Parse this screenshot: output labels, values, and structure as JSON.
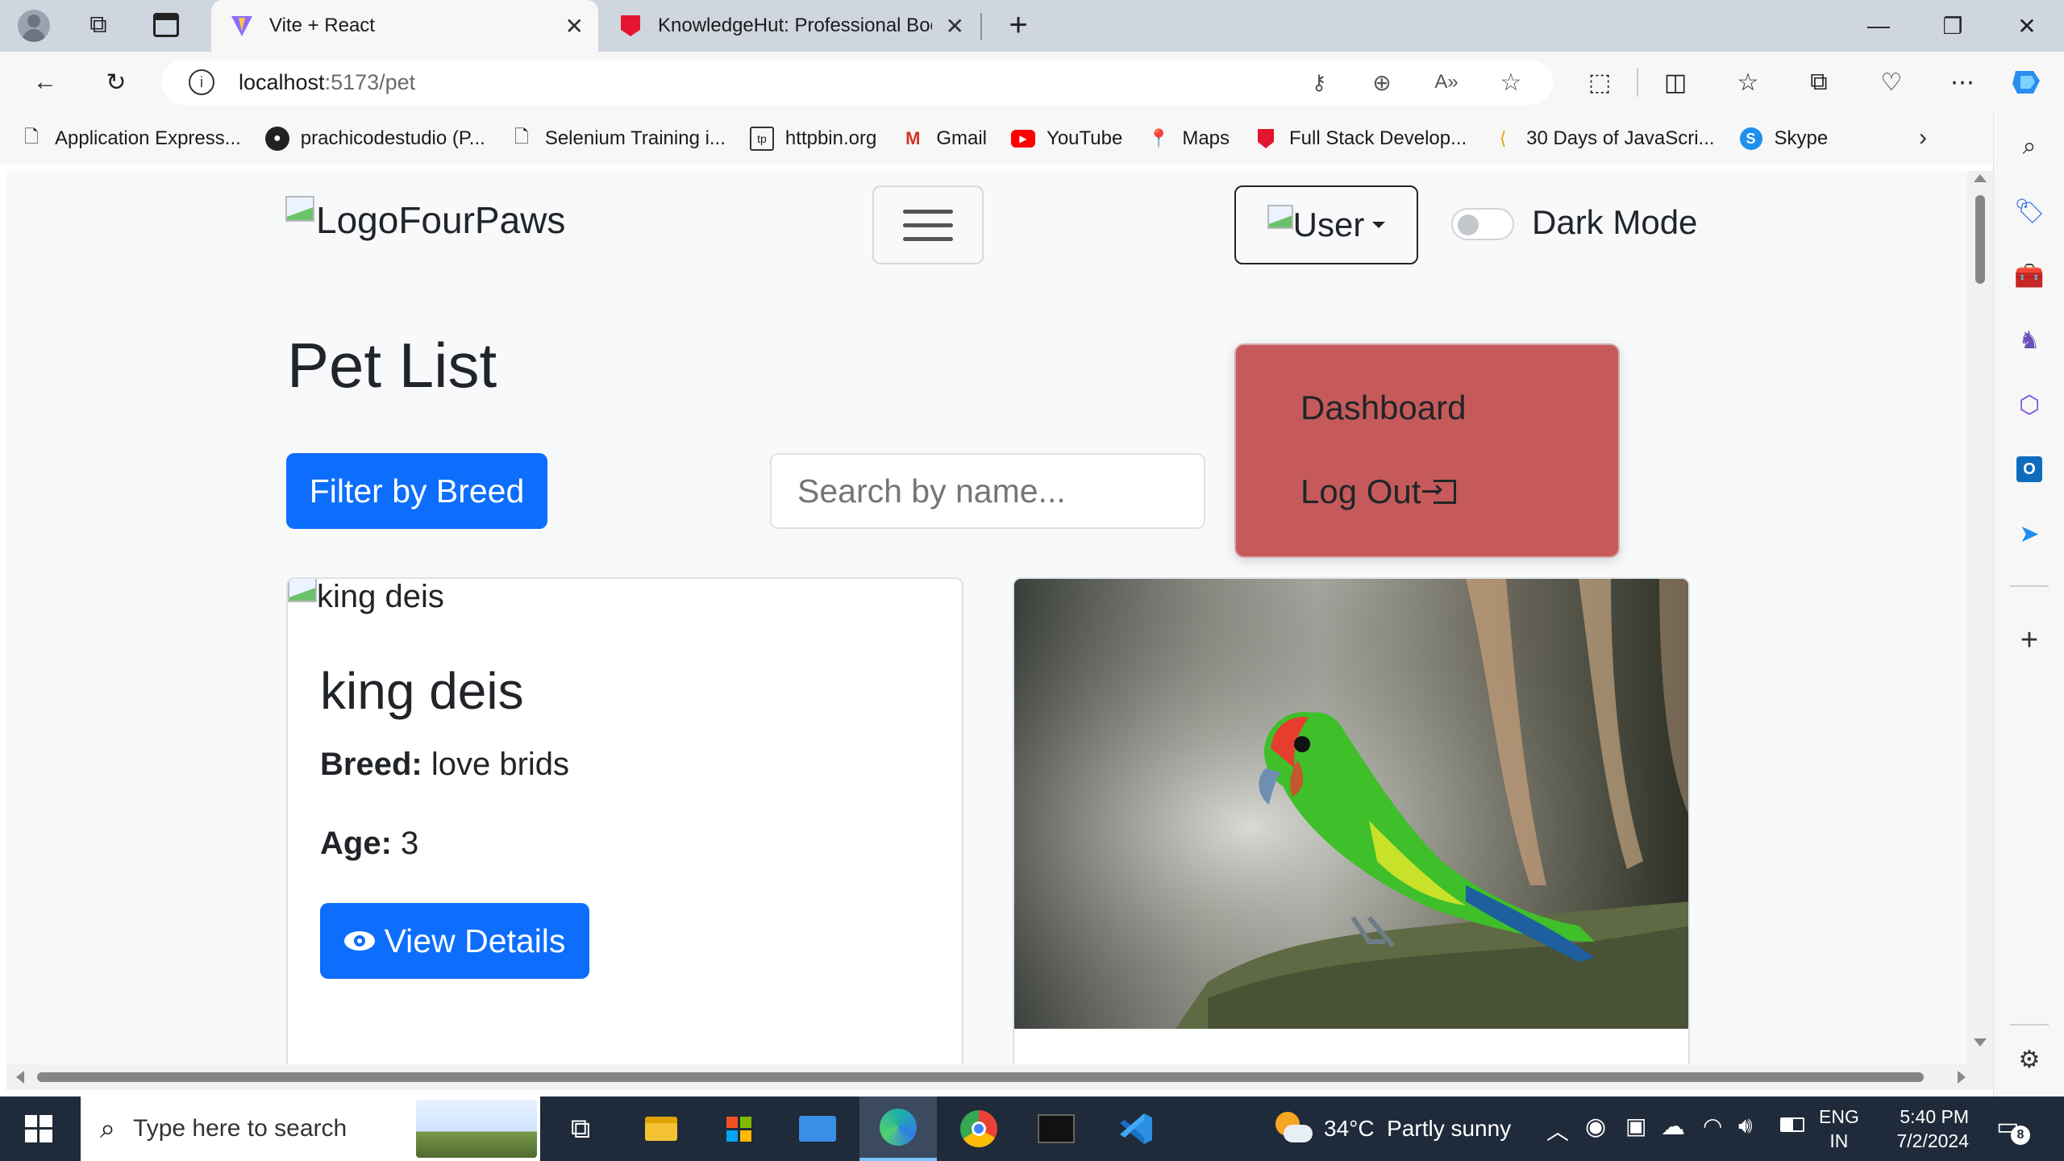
{
  "browser": {
    "tabs": [
      {
        "title": "Vite + React",
        "active": true
      },
      {
        "title": "KnowledgeHut: Professional Boo",
        "active": false
      }
    ],
    "address": {
      "host": "localhost",
      "path": ":5173/pet"
    },
    "bookmarks": [
      {
        "label": "Application Express...",
        "icon": "document-icon"
      },
      {
        "label": "prachicodestudio (P...",
        "icon": "github-icon"
      },
      {
        "label": "Selenium Training i...",
        "icon": "document-icon"
      },
      {
        "label": "httpbin.org",
        "icon": "httpbin-icon"
      },
      {
        "label": "Gmail",
        "icon": "gmail-icon"
      },
      {
        "label": "YouTube",
        "icon": "youtube-icon"
      },
      {
        "label": "Maps",
        "icon": "maps-icon"
      },
      {
        "label": "Full Stack Develop...",
        "icon": "knowledgehut-icon"
      },
      {
        "label": "30 Days of JavaScri...",
        "icon": "js-icon"
      },
      {
        "label": "Skype",
        "icon": "skype-icon"
      }
    ]
  },
  "app": {
    "brand": "LogoFourPaws",
    "user_menu_label": "User",
    "dark_mode_label": "Dark Mode",
    "dark_mode_on": false,
    "dropdown": {
      "items": [
        "Dashboard",
        "Log Out"
      ]
    },
    "page_title": "Pet List",
    "filter_button": "Filter by Breed",
    "search_placeholder": "Search by name...",
    "cards": [
      {
        "image_alt": "king deis",
        "name": "king deis",
        "breed_label": "Breed:",
        "breed": "love brids",
        "age_label": "Age:",
        "age": "3",
        "details_button": "View Details"
      }
    ]
  },
  "taskbar": {
    "search_placeholder": "Type here to search",
    "weather": "34°C  Partly sunny",
    "lang_top": "ENG",
    "lang_bottom": "IN",
    "time": "5:40 PM",
    "date": "7/2/2024",
    "notification_count": "8"
  },
  "colors": {
    "primary": "#0d6efd",
    "dropdown_bg": "#c65a5a",
    "page_bg": "#f8f9fa"
  }
}
